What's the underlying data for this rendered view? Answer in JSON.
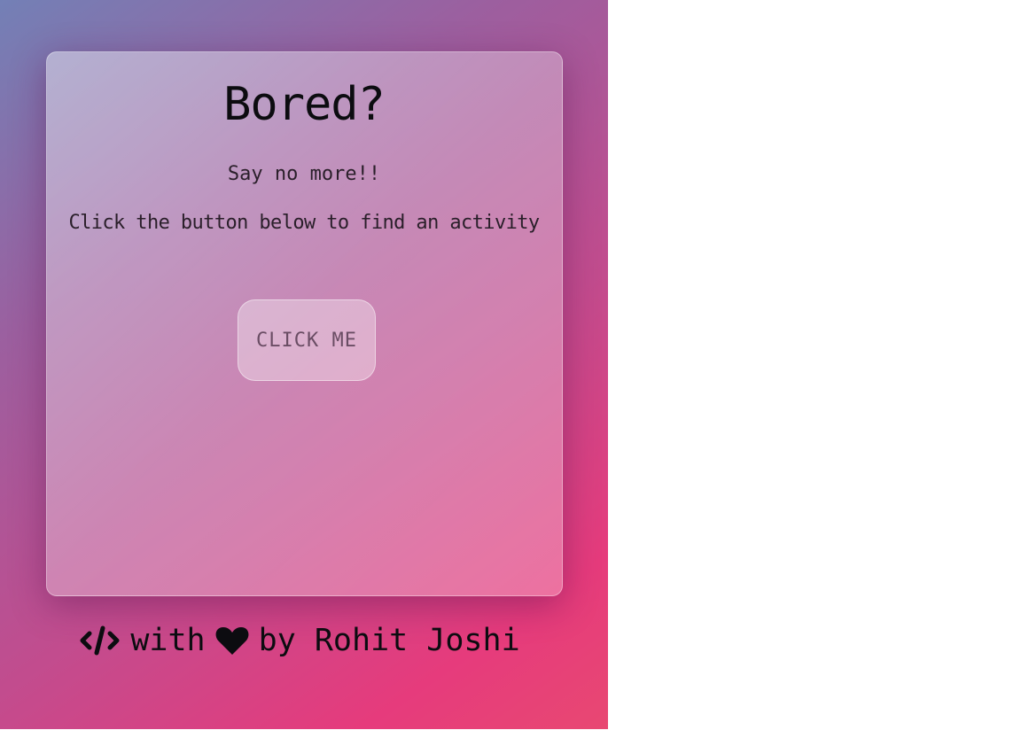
{
  "card": {
    "title": "Bored?",
    "subtitle": "Say no more!!",
    "instruction": "Click the button below to find an activity",
    "button_label": "CLICK ME"
  },
  "footer": {
    "code_icon": "code-icon",
    "with_text": "with",
    "heart_icon": "heart-icon",
    "by_text": "by Rohit Joshi"
  },
  "colors": {
    "gradient_start": "#7380b6",
    "gradient_end": "#e63b7c",
    "text": "#0c0c10"
  }
}
